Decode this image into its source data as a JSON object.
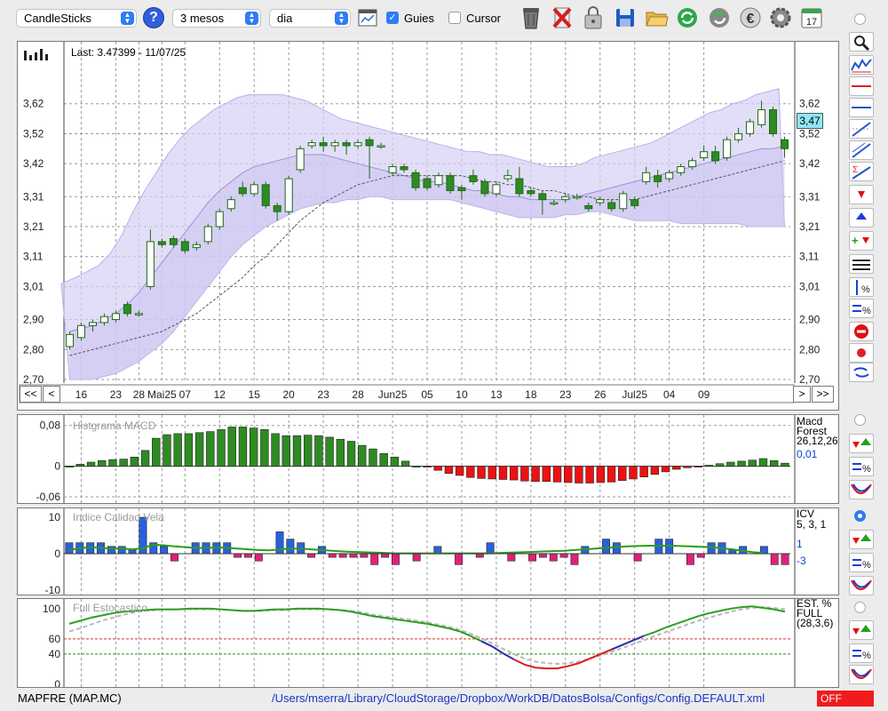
{
  "toolbar": {
    "chart_type": "CandleSticks",
    "period": "3 mesos",
    "interval": "dia",
    "guides_label": "Guies",
    "guides_checked": true,
    "cursor_label": "Cursor",
    "cursor_checked": false,
    "calendar_day": "17",
    "icons": [
      "help-icon",
      "chart-settings-icon",
      "trash-icon",
      "delete-icon",
      "lock-icon",
      "save-icon",
      "open-folder-icon",
      "refresh-icon",
      "sync-icon",
      "euro-icon",
      "gear-icon",
      "calendar-icon"
    ]
  },
  "main": {
    "last_label": "Last: 3.47399 - 11/07/25",
    "current_price_label": "3,47",
    "nav": {
      "first": "<<",
      "prev": "<",
      "next": ">",
      "last": ">>"
    }
  },
  "right_tools": [
    "zoom-icon",
    "bars-icon",
    "horizontal-line-icon",
    "horizontal-line-icon",
    "trend-line-icon",
    "channel-icon",
    "fibonacci-icon",
    "sell-arrow-icon",
    "buy-arrow-icon",
    "add-signal-icon",
    "list-icon",
    "vertical-percent-icon",
    "percent-icon",
    "stop-icon",
    "record-icon",
    "swap-icon"
  ],
  "macd": {
    "title": "Histgrama MACD",
    "name": "Macd",
    "name2": "Forest",
    "params": "26,12,26",
    "value": "0,01"
  },
  "icv": {
    "title": "Indice Calidad Vela",
    "name": "ICV",
    "params": "5, 3, 1",
    "value1": "1",
    "value2": "-3"
  },
  "est": {
    "title": "Full Estocastico",
    "name": "EST. %",
    "name2": "FULL",
    "params": "(28,3,6)"
  },
  "status": {
    "symbol": "MAPFRE (MAP.MC)",
    "path": "/Users/mserra/Library/CloudStorage/Dropbox/WorkDB/DatosBolsa/Configs/Config.DEFAULT.xml",
    "off_label": "OFF"
  },
  "colors": {
    "up": "#ffffff",
    "down": "#2e8b22",
    "band": "#d6d0f5",
    "band_line": "#b8b0e8",
    "macd_pos": "#2e8b22",
    "macd_neg": "#ee1111",
    "icv_pos": "#2a5fe0",
    "icv_neg": "#e0207a",
    "line": "#2a9d1f",
    "accent": "#0b45d8"
  },
  "chart_data": {
    "type": "candlestick",
    "y_ticks": [
      "3,62",
      "3,52",
      "3,42",
      "3,31",
      "3,21",
      "3,11",
      "3,01",
      "2,90",
      "2,80",
      "2,70"
    ],
    "ylim": [
      2.7,
      3.72
    ],
    "x_labels": [
      {
        "i": 1,
        "t": "16"
      },
      {
        "i": 4,
        "t": "23"
      },
      {
        "i": 6,
        "t": "28"
      },
      {
        "i": 8,
        "t": "Mai25"
      },
      {
        "i": 10,
        "t": "07"
      },
      {
        "i": 13,
        "t": "12"
      },
      {
        "i": 16,
        "t": "15"
      },
      {
        "i": 19,
        "t": "20"
      },
      {
        "i": 22,
        "t": "23"
      },
      {
        "i": 25,
        "t": "28"
      },
      {
        "i": 28,
        "t": "Jun25"
      },
      {
        "i": 31,
        "t": "05"
      },
      {
        "i": 34,
        "t": "10"
      },
      {
        "i": 37,
        "t": "13"
      },
      {
        "i": 40,
        "t": "18"
      },
      {
        "i": 43,
        "t": "23"
      },
      {
        "i": 46,
        "t": "26"
      },
      {
        "i": 49,
        "t": "Jul25"
      },
      {
        "i": 52,
        "t": "04"
      },
      {
        "i": 55,
        "t": "09"
      }
    ],
    "candles": [
      [
        2.81,
        2.85,
        2.8,
        2.86
      ],
      [
        2.84,
        2.88,
        2.83,
        2.89
      ],
      [
        2.88,
        2.89,
        2.86,
        2.9
      ],
      [
        2.89,
        2.91,
        2.88,
        2.92
      ],
      [
        2.9,
        2.92,
        2.89,
        2.93
      ],
      [
        2.95,
        2.92,
        2.91,
        2.96
      ],
      [
        2.92,
        2.92,
        2.91,
        2.93
      ],
      [
        3.01,
        3.16,
        3.0,
        3.2
      ],
      [
        3.16,
        3.15,
        3.14,
        3.17
      ],
      [
        3.17,
        3.15,
        3.14,
        3.18
      ],
      [
        3.16,
        3.13,
        3.12,
        3.17
      ],
      [
        3.14,
        3.15,
        3.13,
        3.16
      ],
      [
        3.16,
        3.21,
        3.15,
        3.22
      ],
      [
        3.21,
        3.26,
        3.2,
        3.27
      ],
      [
        3.27,
        3.3,
        3.26,
        3.31
      ],
      [
        3.34,
        3.32,
        3.31,
        3.36
      ],
      [
        3.32,
        3.35,
        3.31,
        3.36
      ],
      [
        3.35,
        3.28,
        3.27,
        3.36
      ],
      [
        3.28,
        3.26,
        3.23,
        3.29
      ],
      [
        3.26,
        3.37,
        3.25,
        3.38
      ],
      [
        3.4,
        3.47,
        3.39,
        3.48
      ],
      [
        3.48,
        3.49,
        3.47,
        3.5
      ],
      [
        3.49,
        3.48,
        3.46,
        3.51
      ],
      [
        3.48,
        3.49,
        3.46,
        3.5
      ],
      [
        3.49,
        3.48,
        3.45,
        3.5
      ],
      [
        3.48,
        3.49,
        3.47,
        3.5
      ],
      [
        3.5,
        3.48,
        3.37,
        3.51
      ],
      [
        3.48,
        3.48,
        3.47,
        3.49
      ],
      [
        3.39,
        3.41,
        3.38,
        3.42
      ],
      [
        3.41,
        3.4,
        3.39,
        3.42
      ],
      [
        3.39,
        3.34,
        3.33,
        3.4
      ],
      [
        3.37,
        3.34,
        3.33,
        3.38
      ],
      [
        3.35,
        3.38,
        3.34,
        3.39
      ],
      [
        3.38,
        3.33,
        3.32,
        3.39
      ],
      [
        3.34,
        3.33,
        3.3,
        3.35
      ],
      [
        3.38,
        3.36,
        3.35,
        3.4
      ],
      [
        3.36,
        3.32,
        3.31,
        3.37
      ],
      [
        3.32,
        3.35,
        3.31,
        3.36
      ],
      [
        3.37,
        3.38,
        3.36,
        3.4
      ],
      [
        3.37,
        3.32,
        3.31,
        3.41
      ],
      [
        3.33,
        3.32,
        3.31,
        3.34
      ],
      [
        3.32,
        3.3,
        3.25,
        3.33
      ],
      [
        3.29,
        3.29,
        3.28,
        3.3
      ],
      [
        3.3,
        3.31,
        3.29,
        3.32
      ],
      [
        3.31,
        3.31,
        3.3,
        3.32
      ],
      [
        3.28,
        3.27,
        3.26,
        3.29
      ],
      [
        3.29,
        3.3,
        3.28,
        3.31
      ],
      [
        3.29,
        3.27,
        3.26,
        3.3
      ],
      [
        3.27,
        3.32,
        3.26,
        3.33
      ],
      [
        3.3,
        3.28,
        3.27,
        3.31
      ],
      [
        3.36,
        3.39,
        3.35,
        3.41
      ],
      [
        3.38,
        3.36,
        3.34,
        3.4
      ],
      [
        3.37,
        3.39,
        3.36,
        3.4
      ],
      [
        3.39,
        3.41,
        3.38,
        3.42
      ],
      [
        3.41,
        3.43,
        3.4,
        3.44
      ],
      [
        3.44,
        3.46,
        3.43,
        3.48
      ],
      [
        3.46,
        3.43,
        3.42,
        3.48
      ],
      [
        3.44,
        3.5,
        3.43,
        3.51
      ],
      [
        3.5,
        3.52,
        3.49,
        3.54
      ],
      [
        3.52,
        3.56,
        3.51,
        3.57
      ],
      [
        3.55,
        3.6,
        3.54,
        3.63
      ],
      [
        3.6,
        3.52,
        3.51,
        3.61
      ],
      [
        3.5,
        3.47,
        3.44,
        3.51
      ]
    ],
    "band_upper": [
      3.02,
      3.04,
      3.06,
      3.08,
      3.12,
      3.18,
      3.26,
      3.33,
      3.39,
      3.45,
      3.5,
      3.54,
      3.57,
      3.6,
      3.62,
      3.64,
      3.65,
      3.65,
      3.65,
      3.65,
      3.64,
      3.63,
      3.61,
      3.59,
      3.57,
      3.56,
      3.55,
      3.54,
      3.53,
      3.52,
      3.51,
      3.5,
      3.49,
      3.48,
      3.47,
      3.46,
      3.46,
      3.45,
      3.45,
      3.44,
      3.43,
      3.42,
      3.41,
      3.41,
      3.41,
      3.42,
      3.44,
      3.45,
      3.46,
      3.47,
      3.48,
      3.49,
      3.51,
      3.53,
      3.55,
      3.57,
      3.59,
      3.6,
      3.62,
      3.63,
      3.65,
      3.66,
      3.67
    ],
    "band_lower": [
      2.7,
      2.7,
      2.7,
      2.71,
      2.72,
      2.74,
      2.76,
      2.79,
      2.82,
      2.86,
      2.91,
      2.96,
      3.01,
      3.06,
      3.11,
      3.15,
      3.18,
      3.21,
      3.23,
      3.25,
      3.27,
      3.28,
      3.29,
      3.29,
      3.3,
      3.3,
      3.31,
      3.31,
      3.3,
      3.3,
      3.3,
      3.3,
      3.3,
      3.3,
      3.29,
      3.28,
      3.27,
      3.26,
      3.25,
      3.24,
      3.24,
      3.24,
      3.24,
      3.25,
      3.25,
      3.26,
      3.26,
      3.25,
      3.24,
      3.23,
      3.23,
      3.23,
      3.23,
      3.22,
      3.22,
      3.22,
      3.22,
      3.22,
      3.22,
      3.21,
      3.21,
      3.21,
      3.21
    ],
    "band_mid": [
      2.86,
      2.87,
      2.88,
      2.9,
      2.92,
      2.95,
      2.99,
      3.04,
      3.09,
      3.14,
      3.19,
      3.24,
      3.29,
      3.33,
      3.36,
      3.39,
      3.41,
      3.42,
      3.43,
      3.44,
      3.45,
      3.45,
      3.45,
      3.44,
      3.43,
      3.42,
      3.41,
      3.4,
      3.39,
      3.38,
      3.37,
      3.36,
      3.36,
      3.35,
      3.34,
      3.33,
      3.33,
      3.32,
      3.31,
      3.31,
      3.3,
      3.3,
      3.3,
      3.3,
      3.31,
      3.32,
      3.33,
      3.34,
      3.35,
      3.36,
      3.37,
      3.38,
      3.39,
      3.4,
      3.41,
      3.42,
      3.43,
      3.44,
      3.45,
      3.46,
      3.47,
      3.47,
      3.48
    ],
    "sma": [
      2.78,
      2.79,
      2.8,
      2.81,
      2.82,
      2.83,
      2.84,
      2.85,
      2.86,
      2.88,
      2.9,
      2.92,
      2.95,
      2.98,
      3.01,
      3.04,
      3.08,
      3.11,
      3.15,
      3.19,
      3.23,
      3.26,
      3.29,
      3.31,
      3.33,
      3.35,
      3.36,
      3.37,
      3.38,
      3.38,
      3.38,
      3.38,
      3.38,
      3.38,
      3.38,
      3.37,
      3.36,
      3.36,
      3.35,
      3.35,
      3.34,
      3.33,
      3.33,
      3.32,
      3.31,
      3.31,
      3.3,
      3.3,
      3.3,
      3.3,
      3.31,
      3.32,
      3.33,
      3.34,
      3.35,
      3.36,
      3.37,
      3.38,
      3.39,
      3.4,
      3.41,
      3.42,
      3.43
    ],
    "macd": {
      "ylim": [
        -0.06,
        0.09
      ],
      "y_ticks": [
        "0,08",
        "0",
        "-0,06"
      ],
      "values": [
        0.0,
        0.004,
        0.008,
        0.011,
        0.013,
        0.014,
        0.018,
        0.031,
        0.055,
        0.062,
        0.064,
        0.064,
        0.066,
        0.068,
        0.072,
        0.077,
        0.077,
        0.075,
        0.072,
        0.064,
        0.06,
        0.06,
        0.061,
        0.06,
        0.057,
        0.053,
        0.049,
        0.041,
        0.034,
        0.025,
        0.018,
        0.01,
        0.0,
        -0.001,
        -0.008,
        -0.014,
        -0.018,
        -0.022,
        -0.024,
        -0.025,
        -0.026,
        -0.027,
        -0.029,
        -0.03,
        -0.03,
        -0.031,
        -0.032,
        -0.033,
        -0.033,
        -0.032,
        -0.031,
        -0.028,
        -0.025,
        -0.021,
        -0.016,
        -0.011,
        -0.006,
        -0.003,
        -0.001,
        0.002,
        0.005,
        0.008,
        0.01,
        0.012,
        0.015,
        0.011,
        0.006
      ]
    },
    "icv": {
      "ylim": [
        -10,
        10
      ],
      "y_ticks": [
        "10",
        "0",
        "-10"
      ],
      "values": [
        3,
        3,
        3,
        3,
        2,
        2,
        1,
        10,
        3,
        2,
        -2,
        0,
        3,
        3,
        3,
        3,
        -1,
        -1,
        -2,
        0,
        6,
        4,
        3,
        -1,
        2,
        -1,
        -1,
        -1,
        -1,
        -3,
        -1,
        -3,
        0,
        -2,
        0,
        2,
        0,
        -3,
        0,
        -1,
        3,
        0,
        -2,
        0,
        -2,
        -1,
        -2,
        -1,
        -3,
        2,
        0,
        4,
        3,
        0,
        -2,
        0,
        4,
        4,
        0,
        -3,
        -1,
        3,
        3,
        1,
        2,
        0,
        2,
        -3,
        -3
      ],
      "line": [
        1,
        1.5,
        1.8,
        1.6,
        1.4,
        1.4,
        1.2,
        1.5,
        2.5,
        2.3,
        2.0,
        1.8,
        1.6,
        1.6,
        1.7,
        1.6,
        1.4,
        1.2,
        1.0,
        0.9,
        1.2,
        1.4,
        1.4,
        1.2,
        1.0,
        0.8,
        0.6,
        0.5,
        0.4,
        0.3,
        0.2,
        0.1,
        0.1,
        0.1,
        0.1,
        0.1,
        0.1,
        0.1,
        0.1,
        0.1,
        0.1,
        0.2,
        0.3,
        0.4,
        0.5,
        0.6,
        0.7,
        0.8,
        1.0,
        1.2,
        1.4,
        1.6,
        1.8,
        2.0,
        2.1,
        2.2,
        2.2,
        2.2,
        2.1,
        2.0,
        1.9,
        1.8,
        1.5,
        1.2,
        0.8,
        0.4,
        0.2
      ]
    },
    "est": {
      "ylim": [
        0,
        108
      ],
      "y_ticks": [
        "100",
        "60",
        "40",
        "0"
      ],
      "k": [
        80,
        84,
        88,
        91,
        94,
        96,
        97,
        98,
        99,
        99,
        99,
        100,
        100,
        100,
        99,
        98,
        97,
        97,
        98,
        99,
        99,
        100,
        100,
        100,
        99,
        98,
        96,
        93,
        90,
        88,
        86,
        84,
        82,
        80,
        77,
        74,
        70,
        64,
        57,
        50,
        41,
        33,
        26,
        22,
        21,
        21,
        24,
        28,
        34,
        40,
        46,
        52,
        58,
        64,
        69,
        75,
        80,
        85,
        90,
        94,
        97,
        100,
        102,
        103,
        101,
        99,
        96
      ],
      "d": [
        70,
        74,
        79,
        84,
        88,
        92,
        95,
        97,
        98,
        99,
        99,
        99,
        99,
        99,
        99,
        98,
        97,
        97,
        97,
        98,
        98,
        99,
        99,
        99,
        99,
        98,
        97,
        95,
        92,
        90,
        88,
        86,
        84,
        82,
        79,
        76,
        72,
        67,
        61,
        54,
        47,
        40,
        34,
        30,
        28,
        27,
        28,
        30,
        34,
        38,
        43,
        48,
        53,
        58,
        64,
        69,
        74,
        79,
        84,
        88,
        92,
        96,
        99,
        101,
        102,
        101,
        99
      ]
    }
  }
}
